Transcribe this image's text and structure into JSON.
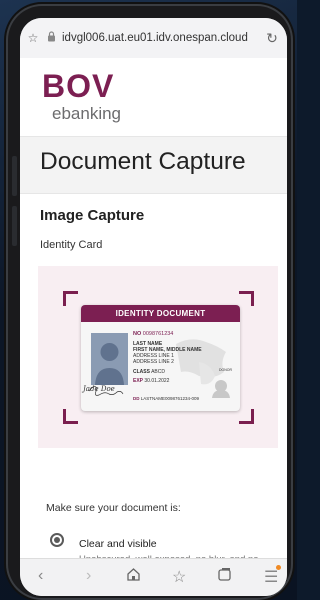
{
  "browser": {
    "url": "idvgl006.uat.eu01.idv.onespan.cloud"
  },
  "logo": {
    "brand": "BOV",
    "sub": "ebanking"
  },
  "page": {
    "title": "Document Capture",
    "section_title": "Image Capture",
    "doc_type": "Identity Card"
  },
  "id_card": {
    "header": "IDENTITY DOCUMENT",
    "no_label": "NO",
    "no_value": "0098761234",
    "last_name": "LAST NAME",
    "first_name": "FIRST NAME, MIDDLE NAME",
    "address1": "ADDRESS LINE 1",
    "address2": "ADDRESS LINE 2",
    "class_label": "CLASS",
    "class_value": "ABCD",
    "exp_label": "EXP",
    "exp_value": "30.01.2022",
    "dd_label": "DD",
    "dd_value": "LASTNAME0098761234-009",
    "signature": "Jade Doe",
    "donor": "DONOR"
  },
  "instructions": {
    "heading": "Make sure your document is:",
    "item1_title": "Clear and visible",
    "item1_desc": "Unobscured, well exposed, no blur, and no"
  },
  "colors": {
    "brand": "#7c1f52",
    "frame_bg": "#f8eef2"
  },
  "icons": [
    "star-icon",
    "lock-icon",
    "reload-icon",
    "back-icon",
    "forward-icon",
    "home-icon",
    "favorites-icon",
    "tabs-icon",
    "menu-icon"
  ]
}
